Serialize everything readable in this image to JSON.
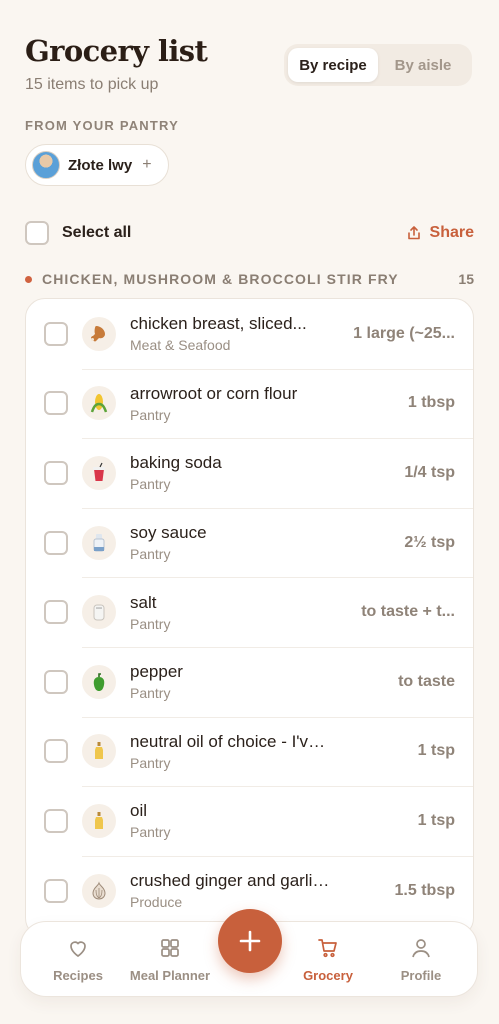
{
  "header": {
    "title": "Grocery list",
    "subtitle": "15 items to pick up"
  },
  "view_toggle": {
    "options": [
      "By recipe",
      "By aisle"
    ],
    "selected": "By recipe"
  },
  "pantry": {
    "label": "FROM YOUR PANTRY",
    "chip_label": "Złote lwy",
    "chip_action": "+"
  },
  "select_all": {
    "label": "Select all",
    "share_label": "Share"
  },
  "section": {
    "title": "CHICKEN, MUSHROOM & BROCCOLI STIR FRY",
    "count": "15"
  },
  "items": [
    {
      "name": "chicken breast, sliced...",
      "category": "Meat & Seafood",
      "qty": "1 large (~25...",
      "icon": "drumstick-icon"
    },
    {
      "name": "arrowroot or corn flour",
      "category": "Pantry",
      "qty": "1 tbsp",
      "icon": "corn-icon"
    },
    {
      "name": "baking soda",
      "category": "Pantry",
      "qty": "1/4 tsp",
      "icon": "cup-icon"
    },
    {
      "name": "soy sauce",
      "category": "Pantry",
      "qty": "2½ tsp",
      "icon": "bottle-icon"
    },
    {
      "name": "salt",
      "category": "Pantry",
      "qty": "to taste + t...",
      "icon": "salt-shaker-icon"
    },
    {
      "name": "pepper",
      "category": "Pantry",
      "qty": "to taste",
      "icon": "bell-pepper-icon"
    },
    {
      "name": "neutral oil of choice - I've used...",
      "category": "Pantry",
      "qty": "1 tsp",
      "icon": "oil-bottle-icon"
    },
    {
      "name": "oil",
      "category": "Pantry",
      "qty": "1 tsp",
      "icon": "oil-bottle-icon"
    },
    {
      "name": "crushed ginger and garlic (...",
      "category": "Produce",
      "qty": "1.5 tbsp",
      "icon": "garlic-icon"
    }
  ],
  "nav": {
    "items": [
      {
        "label": "Recipes",
        "icon": "heart-icon"
      },
      {
        "label": "Meal Planner",
        "icon": "grid-icon"
      },
      {
        "label": "Grocery",
        "icon": "cart-icon",
        "active": true
      },
      {
        "label": "Profile",
        "icon": "person-icon"
      }
    ],
    "fab_icon": "plus-icon"
  },
  "colors": {
    "accent": "#c8603c",
    "background": "#faf6f1"
  }
}
